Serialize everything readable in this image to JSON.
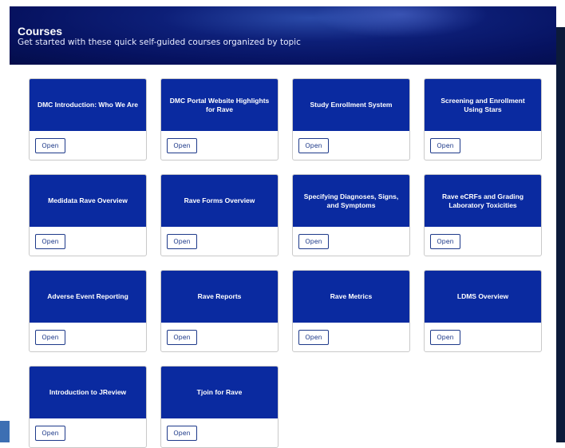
{
  "header": {
    "title": "Courses",
    "subtitle": "Get started with these quick self-guided courses organized by topic"
  },
  "courses": [
    {
      "title": "DMC Introduction: Who We Are",
      "button": "Open"
    },
    {
      "title": "DMC Portal Website Highlights for Rave",
      "button": "Open"
    },
    {
      "title": "Study Enrollment System",
      "button": "Open"
    },
    {
      "title": "Screening and Enrollment Using Stars",
      "button": "Open"
    },
    {
      "title": "Medidata Rave Overview",
      "button": "Open"
    },
    {
      "title": "Rave Forms Overview",
      "button": "Open"
    },
    {
      "title": "Specifying Diagnoses, Signs, and Symptoms",
      "button": "Open"
    },
    {
      "title": "Rave eCRFs and Grading Laboratory Toxicities",
      "button": "Open"
    },
    {
      "title": "Adverse Event Reporting",
      "button": "Open"
    },
    {
      "title": "Rave Reports",
      "button": "Open"
    },
    {
      "title": "Rave Metrics",
      "button": "Open"
    },
    {
      "title": "LDMS Overview",
      "button": "Open"
    },
    {
      "title": "Introduction to JReview",
      "button": "Open"
    },
    {
      "title": "Tjoin for Rave",
      "button": "Open"
    }
  ],
  "colors": {
    "banner": "#0a2aa0",
    "header": "#061260",
    "button_border": "#1e3a8a"
  }
}
